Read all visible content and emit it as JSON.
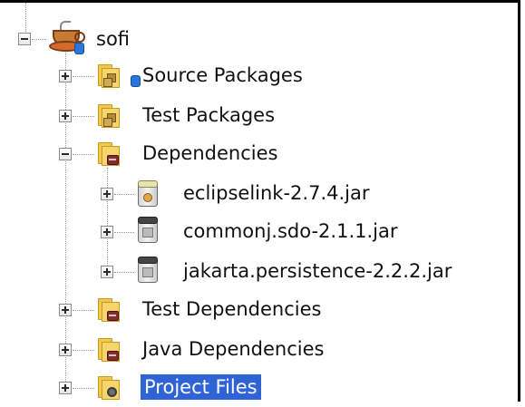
{
  "tree": {
    "project": {
      "label": "sofi",
      "icon": "java-project-icon",
      "expanded": true
    },
    "nodes": [
      {
        "label": "Source Packages",
        "icon": "source-packages-folder-icon",
        "expanded": false
      },
      {
        "label": "Test Packages",
        "icon": "test-packages-folder-icon",
        "expanded": false
      },
      {
        "label": "Dependencies",
        "icon": "dependencies-folder-icon",
        "expanded": true,
        "children": [
          {
            "label": "eclipselink-2.7.4.jar",
            "icon": "jar-icon"
          },
          {
            "label": "commonj.sdo-2.1.1.jar",
            "icon": "jar-icon"
          },
          {
            "label": "jakarta.persistence-2.2.2.jar",
            "icon": "jar-icon"
          }
        ]
      },
      {
        "label": "Test Dependencies",
        "icon": "test-dependencies-folder-icon",
        "expanded": false
      },
      {
        "label": "Java Dependencies",
        "icon": "java-dependencies-folder-icon",
        "expanded": false
      },
      {
        "label": "Project Files",
        "icon": "project-files-folder-icon",
        "expanded": false,
        "selected": true
      }
    ]
  },
  "colors": {
    "selection": "#2f63d6",
    "selection_text": "#ffffff",
    "text": "#111111",
    "border": "#000000"
  }
}
